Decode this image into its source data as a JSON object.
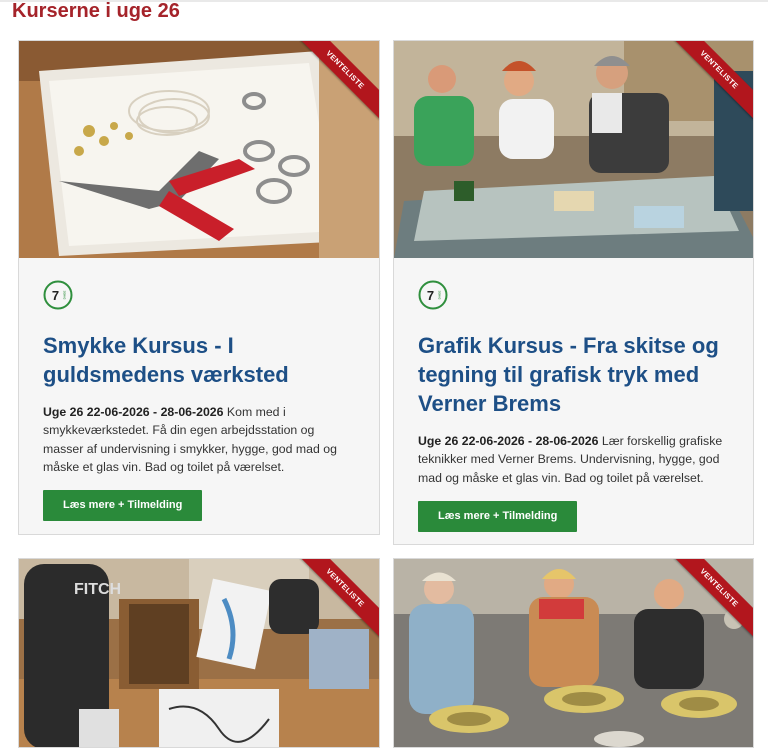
{
  "page": {
    "section_title": "Kurserne i uge 26"
  },
  "colors": {
    "accent_red": "#a5232a",
    "title_blue": "#1d4f86",
    "button_green": "#2a8a3a",
    "ribbon_red": "#b2161d",
    "badge_green": "#2f8f3d"
  },
  "cards": [
    {
      "ribbon": "VENTELISTE",
      "badge_number": "7",
      "badge_suffix": "DAGE",
      "title": "Smykke Kursus - I guldsmedens værksted",
      "date_label": "Uge 26 22-06-2026 - 28-06-2026",
      "description": " Kom med i smykkeværkstedet. Få din egen arbejdsstation og masser af undervisning i smykker, hygge, god mad og måske et glas vin. Bad og toilet på værelset.",
      "button": "Læs mere + Tilmelding"
    },
    {
      "ribbon": "VENTELISTE",
      "badge_number": "7",
      "badge_suffix": "DAGE",
      "title": "Grafik Kursus - Fra skitse og tegning til grafisk tryk med Verner Brems",
      "date_label": "Uge 26 22-06-2026 - 28-06-2026",
      "description": " Lær forskellig grafiske teknikker med Verner Brems. Undervisning, hygge, god mad og måske et glas vin. Bad og toilet på værelset.",
      "button": "Læs mere + Tilmelding"
    },
    {
      "ribbon": "VENTELISTE"
    },
    {
      "ribbon": "VENTELISTE"
    }
  ]
}
